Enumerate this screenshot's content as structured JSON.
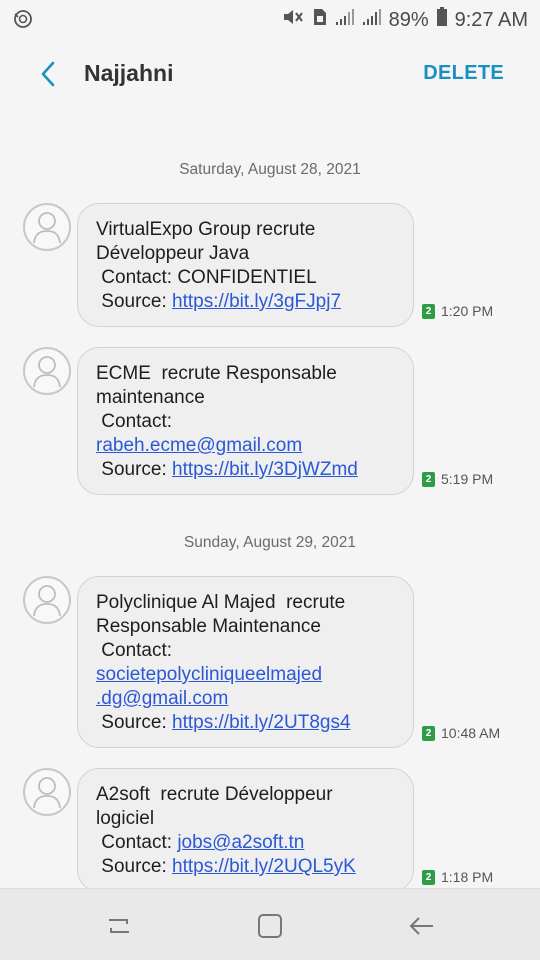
{
  "status_bar": {
    "battery_pct": "89%",
    "time": "9:27 AM",
    "icons": [
      "sync-icon",
      "mute-icon",
      "sim-icon",
      "signal-icon",
      "signal-icon",
      "battery-icon"
    ]
  },
  "app_bar": {
    "title": "Najjahni",
    "delete_label": "DELETE"
  },
  "colors": {
    "accent": "#1b8fc1",
    "link": "#2b58d6",
    "sim_badge": "#2e9d47"
  },
  "dates": [
    "Saturday, August 28, 2021",
    "Sunday, August 29, 2021"
  ],
  "messages": [
    {
      "lines": [
        {
          "text": "VirtualExpo Group recrute"
        },
        {
          "text": "Développeur Java"
        },
        {
          "text": " Contact: CONFIDENTIEL"
        },
        {
          "prefix": " Source: ",
          "link": "https://bit.ly/3gFJpj7"
        }
      ],
      "sim": "2",
      "time": "1:20 PM"
    },
    {
      "lines": [
        {
          "text": "ECME  recrute Responsable"
        },
        {
          "text": "maintenance"
        },
        {
          "text": " Contact:"
        },
        {
          "prefix": "",
          "link": "rabeh.ecme@gmail.com"
        },
        {
          "prefix": " Source: ",
          "link": "https://bit.ly/3DjWZmd"
        }
      ],
      "sim": "2",
      "time": "5:19 PM"
    },
    {
      "lines": [
        {
          "text": "Polyclinique Al Majed  recrute"
        },
        {
          "text": "Responsable Maintenance"
        },
        {
          "text": " Contact:"
        },
        {
          "prefix": "",
          "link": "societepolycliniqueelmajed"
        },
        {
          "prefix": "",
          "link": ".dg@gmail.com"
        },
        {
          "prefix": " Source: ",
          "link": "https://bit.ly/2UT8gs4"
        }
      ],
      "sim": "2",
      "time": "10:48 AM"
    },
    {
      "lines": [
        {
          "text": "A2soft  recrute Développeur"
        },
        {
          "text": "logiciel"
        },
        {
          "prefix": " Contact: ",
          "link": "jobs@a2soft.tn"
        },
        {
          "prefix": " Source: ",
          "link": "https://bit.ly/2UQL5yK"
        }
      ],
      "sim": "2",
      "time": "1:18 PM"
    }
  ],
  "nav_bar": {
    "buttons": [
      "recents-icon",
      "home-icon",
      "back-icon"
    ]
  }
}
